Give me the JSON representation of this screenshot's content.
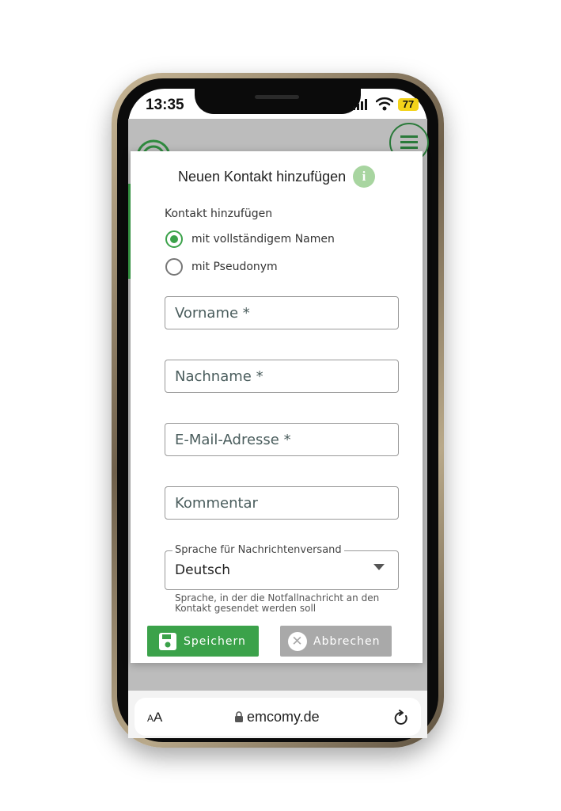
{
  "status_bar": {
    "time": "13:35",
    "battery": "77"
  },
  "modal": {
    "title": "Neuen Kontakt hinzufügen",
    "info_icon_text": "i",
    "add_contact_label": "Kontakt hinzufügen",
    "radio_options": [
      {
        "label": "mit vollständigem Namen",
        "selected": true
      },
      {
        "label": "mit Pseudonym",
        "selected": false
      }
    ],
    "fields": {
      "first_name_placeholder": "Vorname *",
      "last_name_placeholder": "Nachname *",
      "email_placeholder": "E-Mail-Adresse *",
      "comment_placeholder": "Kommentar"
    },
    "language": {
      "legend": "Sprache für Nachrichtenversand",
      "value": "Deutsch",
      "helper": "Sprache, in der die Notfallnachricht an den Kontakt gesendet werden soll"
    },
    "buttons": {
      "save": "Speichern",
      "cancel": "Abbrechen"
    }
  },
  "browser": {
    "aa_small": "A",
    "aa_big": "A",
    "url": "emcomy.de"
  },
  "colors": {
    "accent": "#3ba24a",
    "cancel": "#a9a9a9",
    "info": "#a8d5a0"
  },
  "icons": [
    "info-icon",
    "save-disk-icon",
    "close-circle-icon",
    "lock-icon",
    "reload-icon",
    "menu-icon",
    "wifi-icon",
    "signal-icon",
    "chevron-down-icon"
  ]
}
